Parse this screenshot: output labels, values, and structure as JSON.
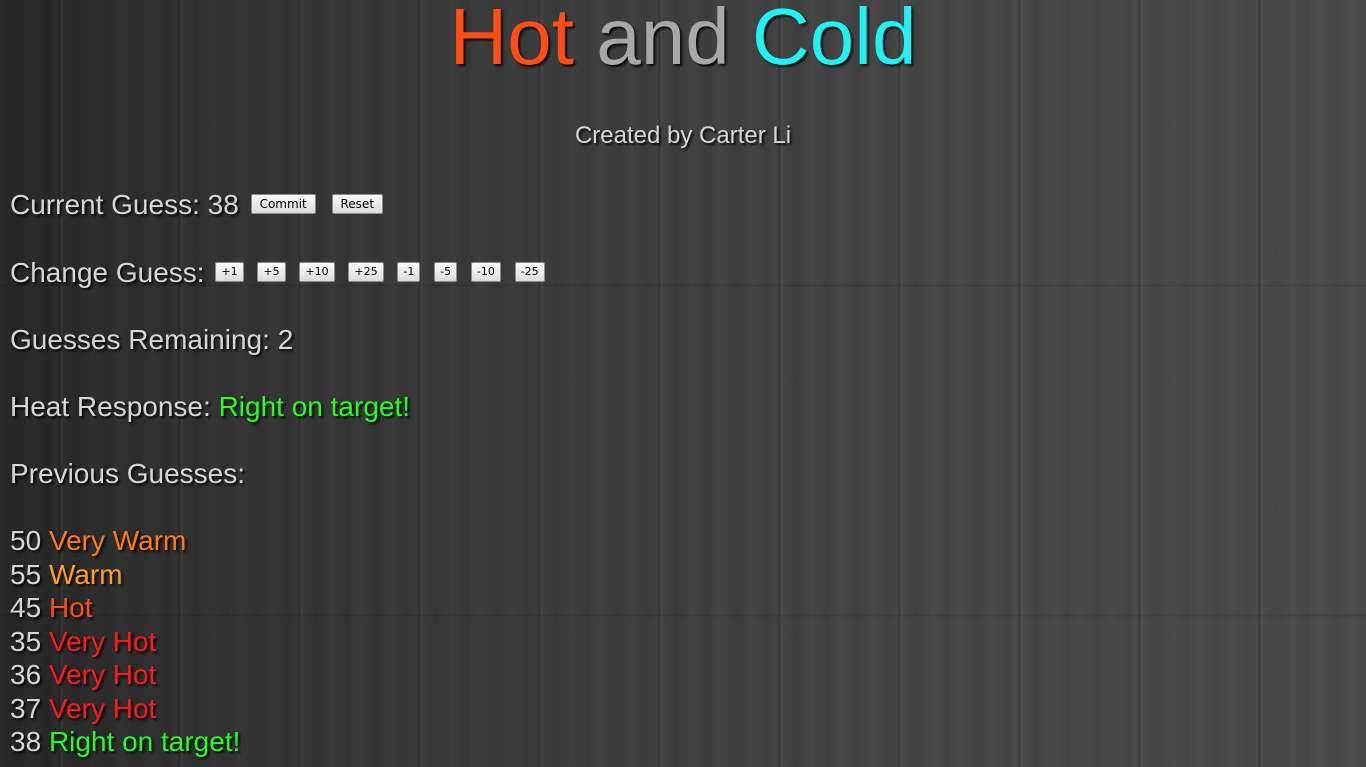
{
  "title": {
    "hot": "Hot",
    "and": "and",
    "cold": "Cold",
    "colors": {
      "hot": "#ff4d14",
      "and": "#a8a8a8",
      "cold": "#1ef2f2"
    }
  },
  "subtitle": "Created by Carter Li",
  "current_guess": {
    "label": "Current Guess:",
    "value": "38",
    "commit_label": "Commit",
    "reset_label": "Reset"
  },
  "change_guess": {
    "label": "Change Guess:",
    "buttons": [
      "+1",
      "+5",
      "+10",
      "+25",
      "-1",
      "-5",
      "-10",
      "-25"
    ]
  },
  "guesses_remaining": {
    "label": "Guesses Remaining:",
    "value": "2"
  },
  "heat_response": {
    "label": "Heat Response:",
    "value": "Right on target!",
    "color": "#22ff22"
  },
  "previous_guesses": {
    "label": "Previous Guesses:",
    "items": [
      {
        "guess": "50",
        "response": "Very Warm",
        "color": "#ff7a12"
      },
      {
        "guess": "55",
        "response": "Warm",
        "color": "#ffa21a"
      },
      {
        "guess": "45",
        "response": "Hot",
        "color": "#ff4d14"
      },
      {
        "guess": "35",
        "response": "Very Hot",
        "color": "#ff1a1a"
      },
      {
        "guess": "36",
        "response": "Very Hot",
        "color": "#ff1a1a"
      },
      {
        "guess": "37",
        "response": "Very Hot",
        "color": "#ff1a1a"
      },
      {
        "guess": "38",
        "response": "Right on target!",
        "color": "#22ff22"
      }
    ]
  }
}
